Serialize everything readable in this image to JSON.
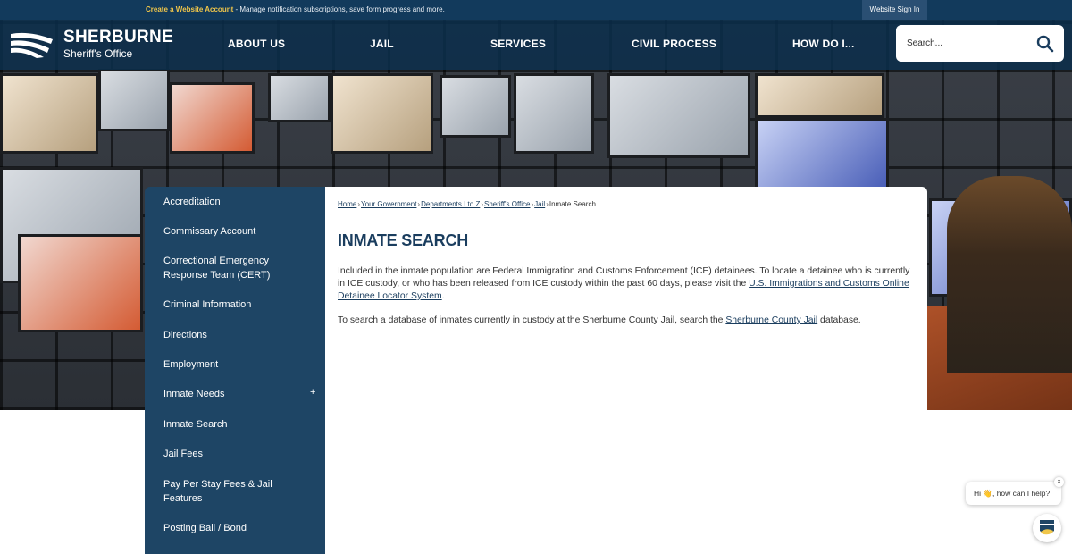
{
  "topbar": {
    "create_link": "Create a Website Account",
    "message": " - Manage notification subscriptions, save form progress and more.",
    "signin_label": "Website Sign In"
  },
  "brand": {
    "name": "SHERBURNE",
    "subtitle": "Sheriff's Office"
  },
  "nav": {
    "items": [
      {
        "label": "ABOUT US"
      },
      {
        "label": "JAIL"
      },
      {
        "label": "SERVICES"
      },
      {
        "label": "CIVIL PROCESS"
      },
      {
        "label": "HOW DO I..."
      }
    ]
  },
  "search": {
    "placeholder": "Search..."
  },
  "sidebar": {
    "items": [
      {
        "label": "Accreditation"
      },
      {
        "label": "Commissary Account"
      },
      {
        "label": "Correctional Emergency Response Team (CERT)"
      },
      {
        "label": "Criminal Information"
      },
      {
        "label": "Directions"
      },
      {
        "label": "Employment"
      },
      {
        "label": "Inmate Needs",
        "expander": "+"
      },
      {
        "label": "Inmate Search"
      },
      {
        "label": "Jail Fees"
      },
      {
        "label": "Pay Per Stay Fees & Jail Features"
      },
      {
        "label": "Posting Bail / Bond"
      }
    ]
  },
  "breadcrumb": {
    "items": [
      "Home",
      "Your Government",
      "Departments I to Z",
      "Sheriff's Office",
      "Jail"
    ],
    "current": "Inmate Search",
    "separator": "›"
  },
  "content": {
    "title": "INMATE SEARCH",
    "p1_text": "Included in the inmate population are Federal Immigration and Customs Enforcement (ICE) detainees. To locate a detainee who is currently in ICE custody, or who has been released from ICE custody within the past 60 days, please visit the ",
    "p1_link": "U.S. Immigrations and Customs Online Detainee Locator System",
    "p1_end": ".",
    "p2_text": "To search a database of inmates currently in custody at the Sherburne County Jail, search the ",
    "p2_link": "Sherburne County Jail",
    "p2_end": " database."
  },
  "chat": {
    "greeting": "Hi 👋, how can I help?",
    "close": "×"
  },
  "colors": {
    "nav_bg": "#0a2d4b",
    "sidebar_bg": "#1e4565",
    "accent_link": "#f0c64a",
    "title": "#1a3d5e"
  }
}
